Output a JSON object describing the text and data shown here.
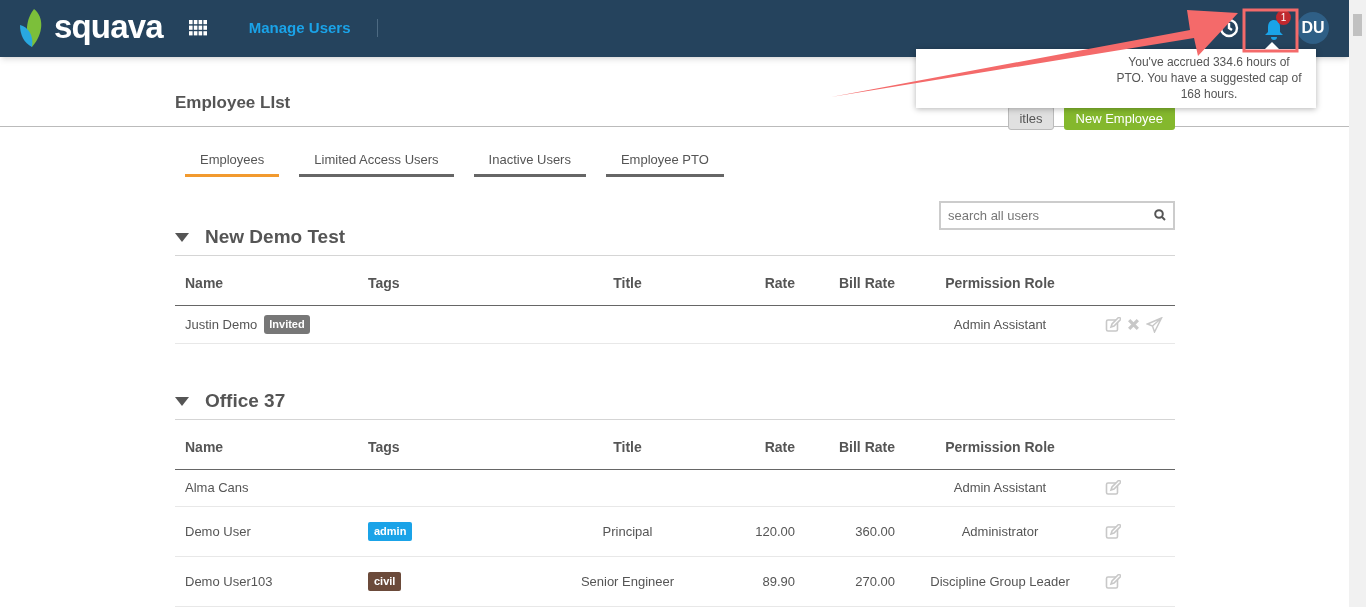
{
  "header": {
    "logo": "squava",
    "page_title": "Manage Users",
    "notification_count": "1",
    "avatar": "DU"
  },
  "popup": {
    "message": "You've accrued 334.6 hours of PTO. You have a suggested cap of 168 hours."
  },
  "page": {
    "title": "Employee LIst",
    "buttons": [
      {
        "label": "itles",
        "kind": "secondary"
      },
      {
        "label": "New Employee",
        "kind": "primary"
      }
    ]
  },
  "tabs": [
    {
      "label": "Employees",
      "selected": true
    },
    {
      "label": "Limited Access Users",
      "selected": false
    },
    {
      "label": "Inactive Users",
      "selected": false
    },
    {
      "label": "Employee PTO",
      "selected": false
    }
  ],
  "search": {
    "placeholder": "search all users"
  },
  "groups": [
    {
      "name": "New Demo Test",
      "expanded": true,
      "columns": [
        "Name",
        "Tags",
        "Title",
        "Rate",
        "Bill Rate",
        "Permission Role"
      ],
      "rows": [
        {
          "name": "Justin Demo",
          "status": "Invited",
          "tags": [],
          "title": "",
          "rate": "",
          "bill_rate": "",
          "role": "Admin Assistant",
          "deletable": true,
          "resendable": true
        }
      ]
    },
    {
      "name": "Office 37",
      "expanded": true,
      "columns": [
        "Name",
        "Tags",
        "Title",
        "Rate",
        "Bill Rate",
        "Permission Role"
      ],
      "rows": [
        {
          "name": "Alma Cans",
          "tags": [],
          "title": "",
          "rate": "",
          "bill_rate": "",
          "role": "Admin Assistant",
          "deletable": false,
          "resendable": false
        },
        {
          "name": "Demo User",
          "tags": [
            {
              "label": "admin",
              "color": "#1aa3e8"
            }
          ],
          "title": "Principal",
          "rate": "120.00",
          "bill_rate": "360.00",
          "role": "Administrator",
          "deletable": false,
          "resendable": false
        },
        {
          "name": "Demo User103",
          "tags": [
            {
              "label": "civil",
              "color": "#6b4a3a"
            }
          ],
          "title": "Senior Engineer",
          "rate": "89.90",
          "bill_rate": "270.00",
          "role": "Discipline Group Leader",
          "deletable": false,
          "resendable": false
        }
      ]
    }
  ]
}
